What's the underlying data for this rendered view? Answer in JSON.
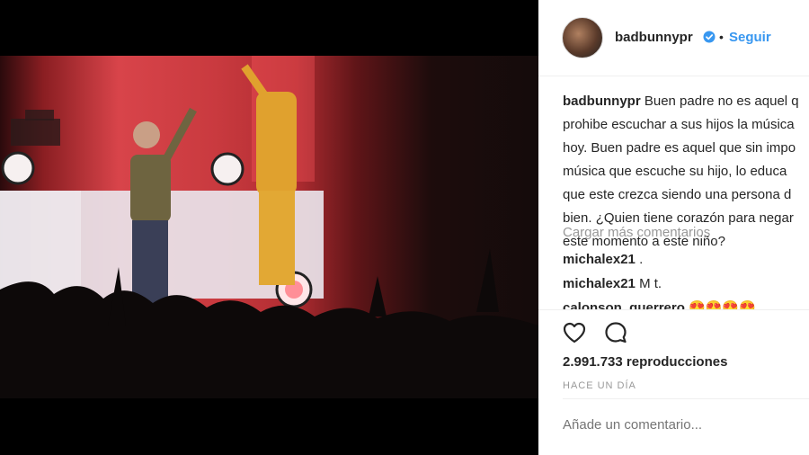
{
  "post": {
    "username": "badbunnypr",
    "follow_label": "Seguir",
    "separator": "•"
  },
  "caption": {
    "author": "badbunnypr",
    "lines": [
      "Buen padre no es aquel q",
      "prohibe escuchar a sus hijos la música",
      "hoy. Buen padre es aquel que sin impo",
      "música que escuche su hijo, lo educa",
      "que este crezca siendo una persona d",
      "bien. ¿Quien tiene corazón para negar",
      "este momento a este niño?"
    ]
  },
  "load_more_label": "Cargar más comentarios",
  "comments": [
    {
      "user": "michalex21",
      "text": "."
    },
    {
      "user": "michalex21",
      "text": "M t."
    },
    {
      "user": "calonson_guerrero",
      "text": "😍😍😍😍"
    }
  ],
  "stats": {
    "views": "2.991.733 reproducciones",
    "time_ago": "HACE UN DÍA"
  },
  "comment_input": {
    "placeholder": "Añade un comentario..."
  },
  "icons": {
    "verified": "verified-badge-icon",
    "like": "heart-icon",
    "comment": "comment-bubble-icon"
  },
  "colors": {
    "link_blue": "#3897f0",
    "text": "#262626",
    "muted": "#999999",
    "verified": "#3897f0"
  }
}
